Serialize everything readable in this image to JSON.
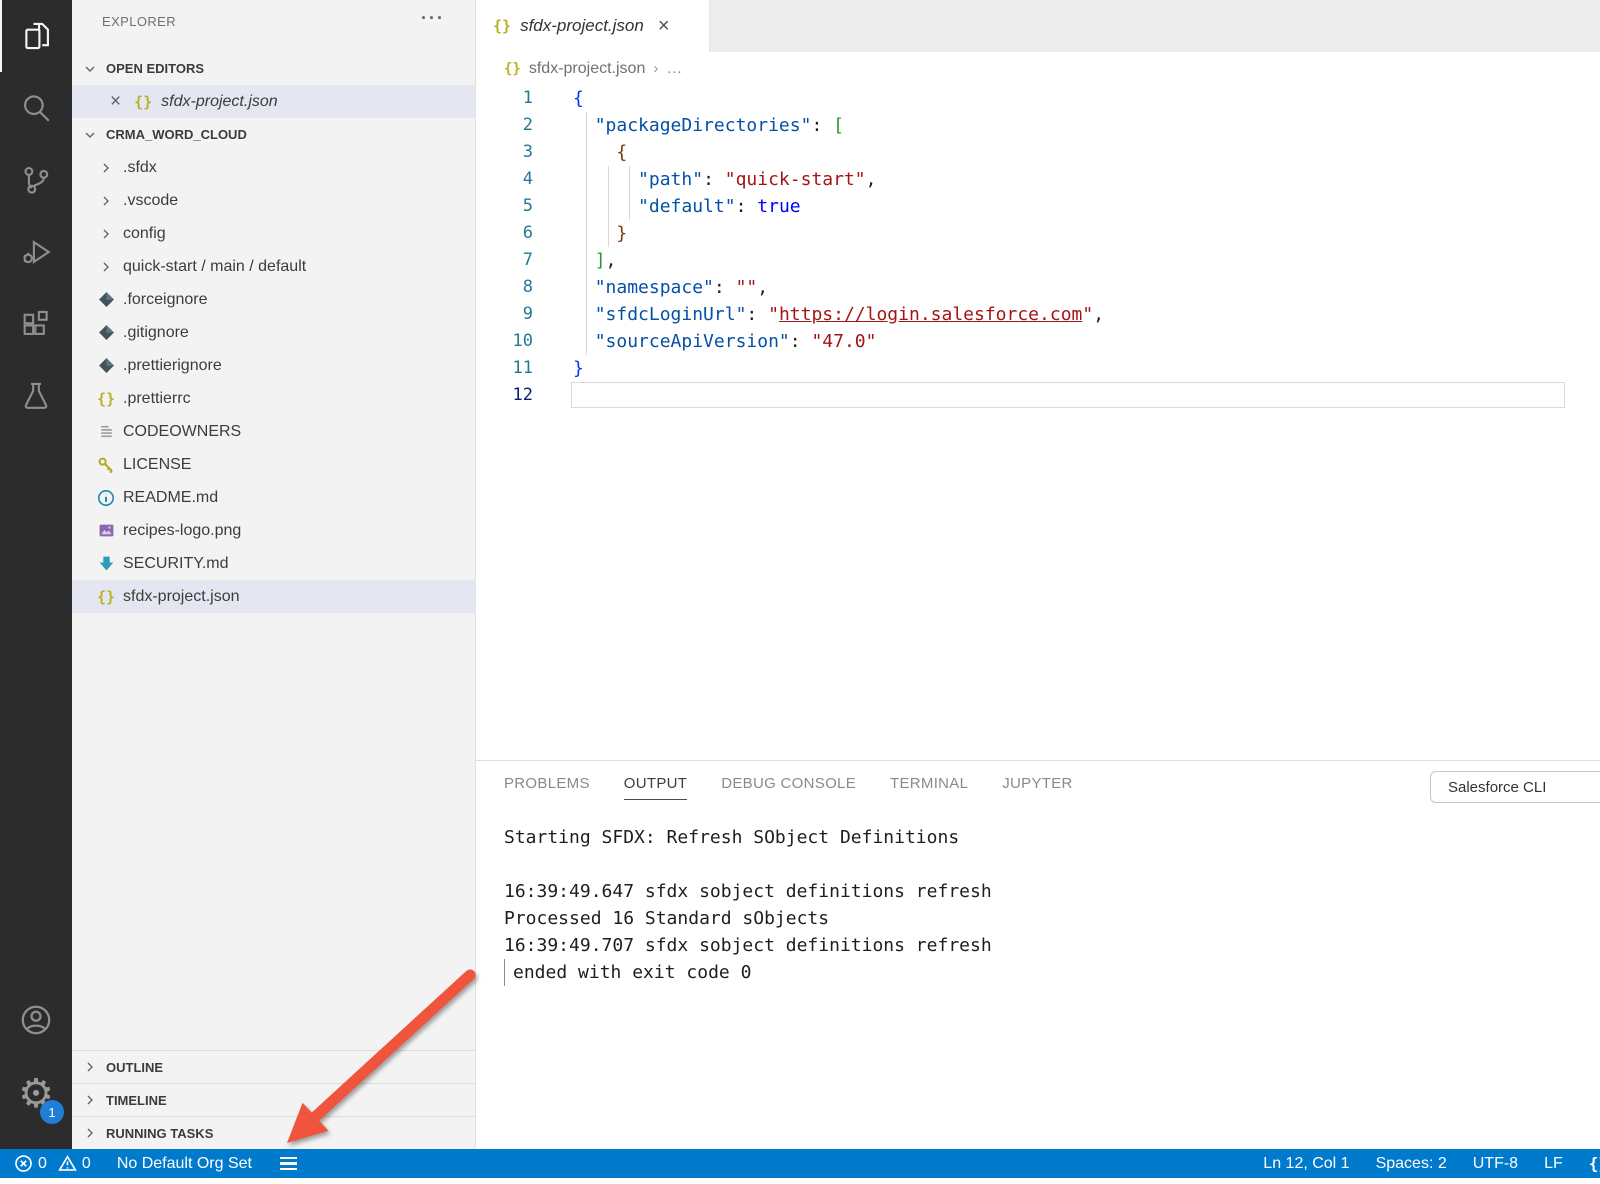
{
  "colors": {
    "status_bar": "#007acc",
    "activity_bar": "#2c2c2c",
    "sidebar": "#f3f3f3",
    "selection": "#e4e6f1",
    "arrow": "#f0543d",
    "json_icon": "#b8b322"
  },
  "activity_bar": {
    "badge": "1"
  },
  "explorer": {
    "title": "EXPLORER",
    "more": "···",
    "open_editors_label": "OPEN EDITORS",
    "open_editor_file": "sfdx-project.json",
    "open_editor_close": "×",
    "project_label": "CRMA_WORD_CLOUD",
    "tree": [
      {
        "label": ".sfdx",
        "icon": "chevron"
      },
      {
        "label": ".vscode",
        "icon": "chevron"
      },
      {
        "label": "config",
        "icon": "chevron"
      },
      {
        "label": "quick-start / main / default",
        "icon": "chevron"
      },
      {
        "label": ".forceignore",
        "icon": "ignore"
      },
      {
        "label": ".gitignore",
        "icon": "ignore"
      },
      {
        "label": ".prettierignore",
        "icon": "ignore"
      },
      {
        "label": ".prettierrc",
        "icon": "json"
      },
      {
        "label": "CODEOWNERS",
        "icon": "lines"
      },
      {
        "label": "LICENSE",
        "icon": "key"
      },
      {
        "label": "README.md",
        "icon": "info"
      },
      {
        "label": "recipes-logo.png",
        "icon": "image"
      },
      {
        "label": "SECURITY.md",
        "icon": "arrow-down"
      },
      {
        "label": "sfdx-project.json",
        "icon": "json",
        "selected": true
      }
    ],
    "sections": [
      "OUTLINE",
      "TIMELINE",
      "RUNNING TASKS"
    ]
  },
  "editor": {
    "tab_file": "sfdx-project.json",
    "tab_close": "×",
    "breadcrumb_file": "sfdx-project.json",
    "breadcrumb_sep": "›",
    "breadcrumb_more": "…",
    "code_lines": [
      {
        "n": "1",
        "guides": [],
        "tokens": [
          {
            "t": "{",
            "c": "b1"
          }
        ]
      },
      {
        "n": "2",
        "guides": [
          1
        ],
        "tokens": [
          {
            "t": "  ",
            "c": "p"
          },
          {
            "t": "\"packageDirectories\"",
            "c": "key"
          },
          {
            "t": ": ",
            "c": "p"
          },
          {
            "t": "[",
            "c": "b2"
          }
        ]
      },
      {
        "n": "3",
        "guides": [
          1
        ],
        "tokens": [
          {
            "t": "    ",
            "c": "p"
          },
          {
            "t": "{",
            "c": "b3"
          }
        ]
      },
      {
        "n": "4",
        "guides": [
          1,
          3,
          5
        ],
        "tokens": [
          {
            "t": "      ",
            "c": "p"
          },
          {
            "t": "\"path\"",
            "c": "key"
          },
          {
            "t": ": ",
            "c": "p"
          },
          {
            "t": "\"quick-start\"",
            "c": "str"
          },
          {
            "t": ",",
            "c": "p"
          }
        ]
      },
      {
        "n": "5",
        "guides": [
          1,
          3,
          5
        ],
        "tokens": [
          {
            "t": "      ",
            "c": "p"
          },
          {
            "t": "\"default\"",
            "c": "key"
          },
          {
            "t": ": ",
            "c": "p"
          },
          {
            "t": "true",
            "c": "kw"
          }
        ]
      },
      {
        "n": "6",
        "guides": [
          1,
          3
        ],
        "tokens": [
          {
            "t": "    ",
            "c": "p"
          },
          {
            "t": "}",
            "c": "b3"
          }
        ]
      },
      {
        "n": "7",
        "guides": [
          1
        ],
        "tokens": [
          {
            "t": "  ",
            "c": "p"
          },
          {
            "t": "]",
            "c": "b2"
          },
          {
            "t": ",",
            "c": "p"
          }
        ]
      },
      {
        "n": "8",
        "guides": [
          1
        ],
        "tokens": [
          {
            "t": "  ",
            "c": "p"
          },
          {
            "t": "\"namespace\"",
            "c": "key"
          },
          {
            "t": ": ",
            "c": "p"
          },
          {
            "t": "\"\"",
            "c": "str"
          },
          {
            "t": ",",
            "c": "p"
          }
        ]
      },
      {
        "n": "9",
        "guides": [
          1
        ],
        "tokens": [
          {
            "t": "  ",
            "c": "p"
          },
          {
            "t": "\"sfdcLoginUrl\"",
            "c": "key"
          },
          {
            "t": ": ",
            "c": "p"
          },
          {
            "t": "\"",
            "c": "str"
          },
          {
            "t": "https://login.salesforce.com",
            "c": "link"
          },
          {
            "t": "\"",
            "c": "str"
          },
          {
            "t": ",",
            "c": "p"
          }
        ]
      },
      {
        "n": "10",
        "guides": [
          1
        ],
        "tokens": [
          {
            "t": "  ",
            "c": "p"
          },
          {
            "t": "\"sourceApiVersion\"",
            "c": "key"
          },
          {
            "t": ": ",
            "c": "p"
          },
          {
            "t": "\"47.0\"",
            "c": "str"
          }
        ]
      },
      {
        "n": "11",
        "guides": [],
        "tokens": [
          {
            "t": "}",
            "c": "b1"
          }
        ]
      },
      {
        "n": "12",
        "guides": [],
        "tokens": [],
        "current": true
      }
    ]
  },
  "panel": {
    "tabs": [
      {
        "label": "PROBLEMS",
        "active": false
      },
      {
        "label": "OUTPUT",
        "active": true
      },
      {
        "label": "DEBUG CONSOLE",
        "active": false
      },
      {
        "label": "TERMINAL",
        "active": false
      },
      {
        "label": "JUPYTER",
        "active": false
      }
    ],
    "channel_dropdown": "Salesforce CLI",
    "output_lines": [
      {
        "text": "Starting SFDX: Refresh SObject Definitions",
        "cursor": false
      },
      {
        "text": "",
        "cursor": false
      },
      {
        "text": "16:39:49.647 sfdx sobject definitions refresh",
        "cursor": false
      },
      {
        "text": "Processed 16 Standard sObjects",
        "cursor": false
      },
      {
        "text": "16:39:49.707 sfdx sobject definitions refresh",
        "cursor": false
      },
      {
        "text": "ended with exit code 0",
        "cursor": true
      }
    ]
  },
  "status_bar": {
    "errors": "0",
    "warnings": "0",
    "org_status": "No Default Org Set",
    "right": [
      "Ln 12, Col 1",
      "Spaces: 2",
      "UTF-8",
      "LF",
      "{}"
    ]
  }
}
